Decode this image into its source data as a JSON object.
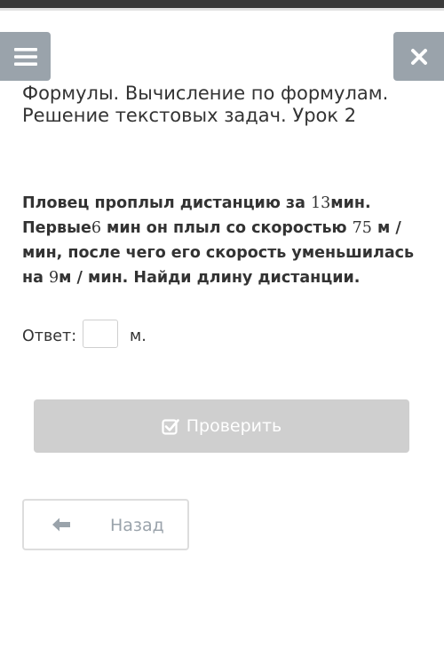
{
  "header": {
    "menu_icon": "hamburger-menu-icon",
    "close_icon": "close-x-icon"
  },
  "lesson": {
    "title": "Формулы. Вычисление по формулам. Решение текстовых задач. Урок 2"
  },
  "problem": {
    "t1": "Пловец проплыл дистанцию за ",
    "n1": "13",
    "t2": "мин. Первые",
    "n2": "6",
    "t3": " мин он плыл со скоростью ",
    "n3": "75",
    "t4": " м / мин, после чего его скорость уменьшилась на ",
    "n4": "9",
    "t5": "м / мин. Найди длину дистанции."
  },
  "answer": {
    "label": "Ответ:",
    "value": "",
    "unit": "м."
  },
  "buttons": {
    "check_label": "Проверить",
    "check_icon": "checkbox-check-icon",
    "back_label": "Назад",
    "back_icon": "arrow-left-icon"
  },
  "colors": {
    "topbar": "#3a3a3a",
    "icon_button_bg": "#9aa3ab",
    "check_button_bg": "#cfcfcf",
    "text": "#333333",
    "back_label": "#9aa3ab"
  }
}
